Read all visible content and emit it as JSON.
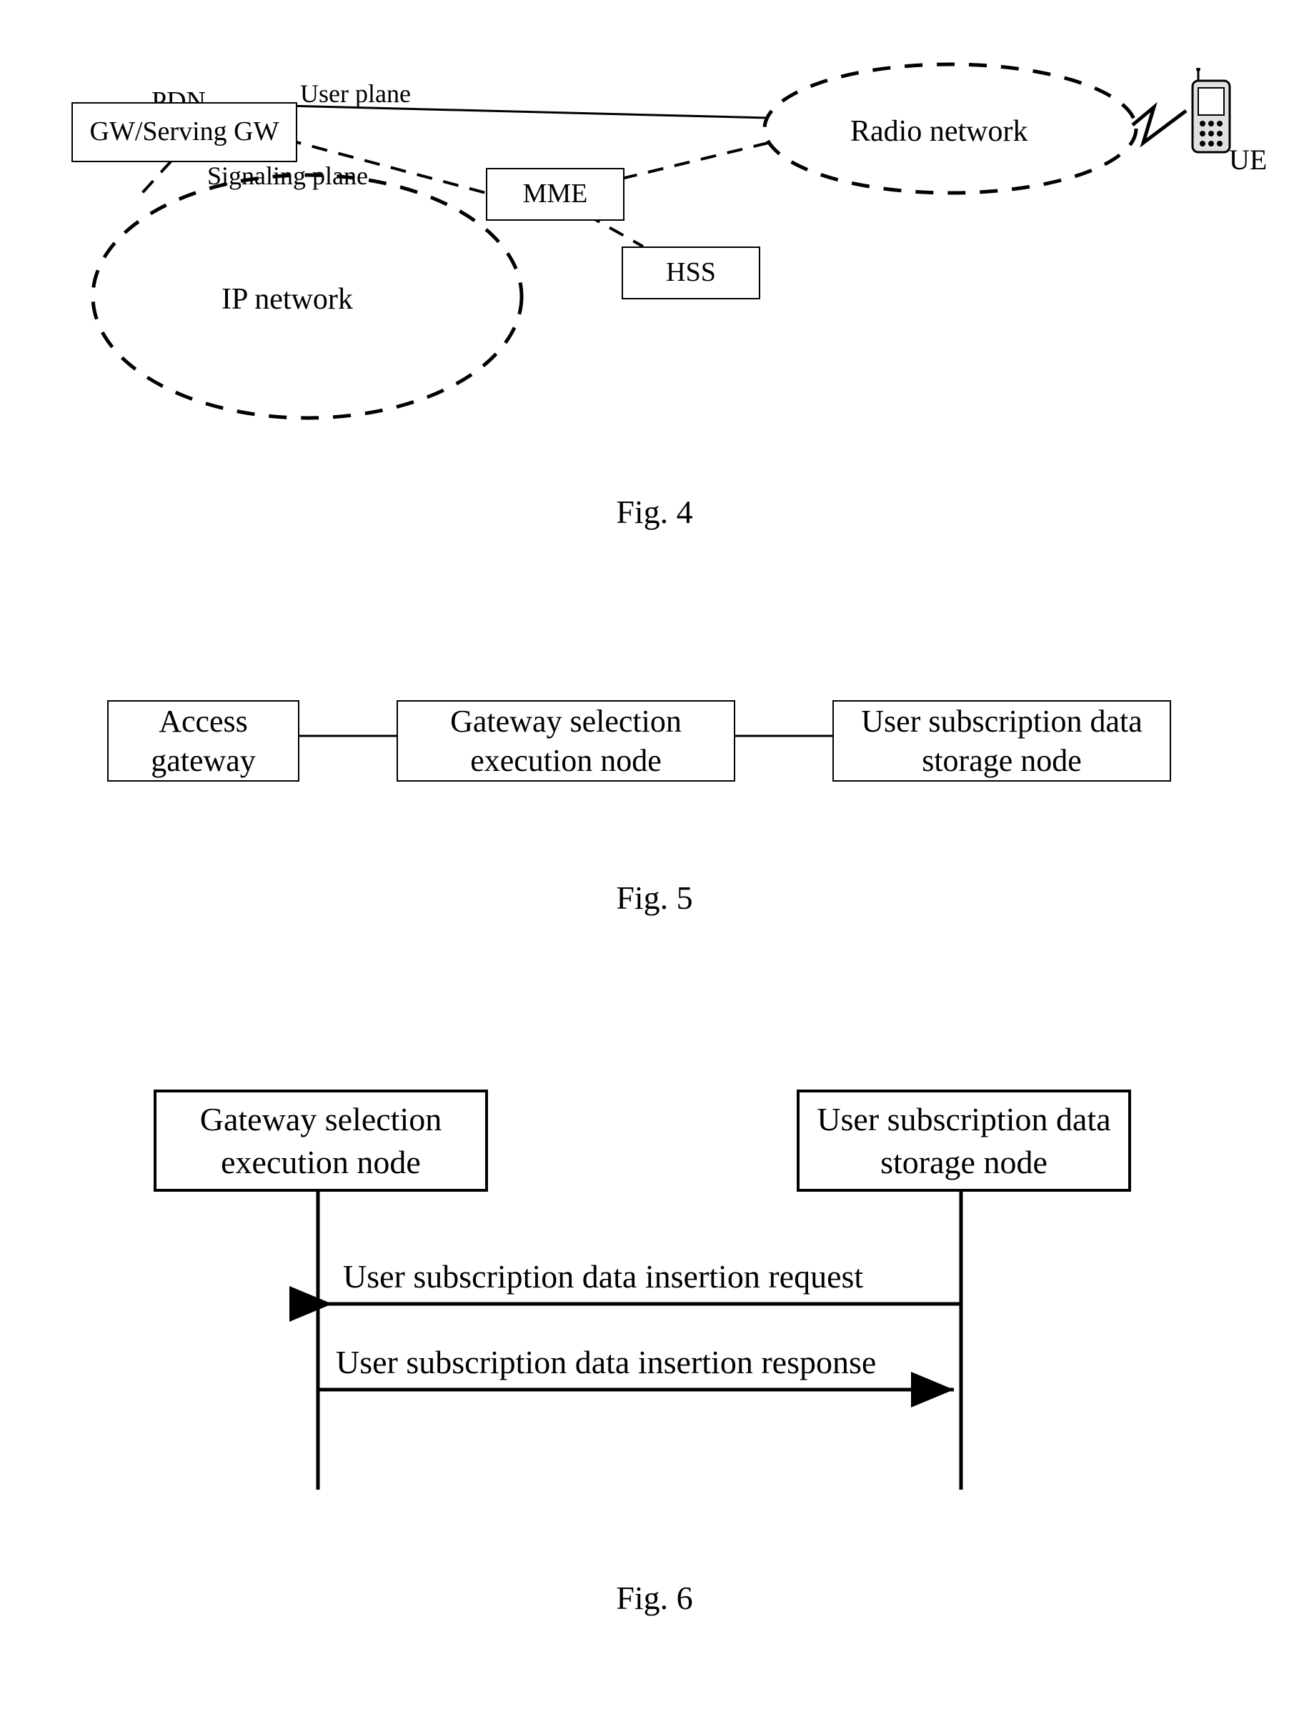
{
  "fig4": {
    "caption": "Fig. 4",
    "nodes": {
      "gw_top_label": "PDN",
      "gw_label": "GW/Serving GW",
      "mme": "MME",
      "hss": "HSS",
      "ip_network": "IP network",
      "radio_network": "Radio network",
      "ue": "UE",
      "user_plane": "User plane",
      "signaling_plane": "Signaling plane"
    }
  },
  "fig5": {
    "caption": "Fig. 5",
    "nodes": {
      "access_gateway": "Access gateway",
      "gw_sel_exec": "Gateway selection execution node",
      "user_sub_storage": "User subscription data storage node"
    }
  },
  "fig6": {
    "caption": "Fig. 6",
    "nodes": {
      "gw_sel_exec": "Gateway selection execution node",
      "user_sub_storage": "User subscription data storage node"
    },
    "messages": {
      "req": "User subscription data insertion request",
      "resp": "User subscription data insertion response"
    }
  }
}
